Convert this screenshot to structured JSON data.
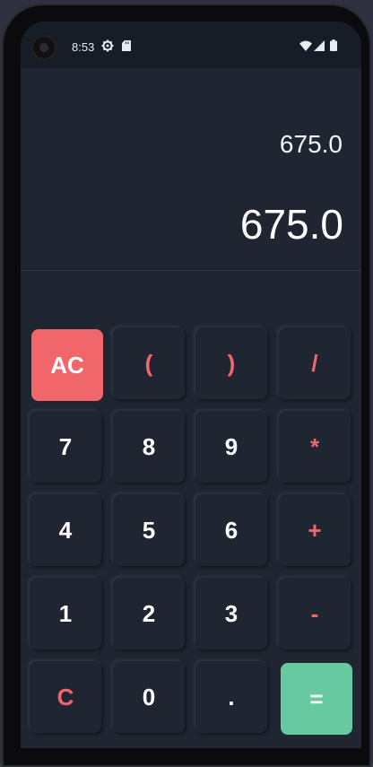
{
  "status_bar": {
    "time": "8:53",
    "icons": [
      "gear-icon",
      "sd-card-icon",
      "wifi-icon",
      "signal-icon",
      "battery-icon"
    ]
  },
  "display": {
    "expression": "675.0",
    "result": "675.0"
  },
  "keys": {
    "ac": "AC",
    "open_paren": "(",
    "close_paren": ")",
    "divide": "/",
    "seven": "7",
    "eight": "8",
    "nine": "9",
    "multiply": "*",
    "four": "4",
    "five": "5",
    "six": "6",
    "plus": "+",
    "one": "1",
    "two": "2",
    "three": "3",
    "minus": "-",
    "clear": "C",
    "zero": "0",
    "dot": ".",
    "equals": "="
  },
  "colors": {
    "accent": "#f0666a",
    "equals": "#66c9a0",
    "background": "#1f2632"
  }
}
